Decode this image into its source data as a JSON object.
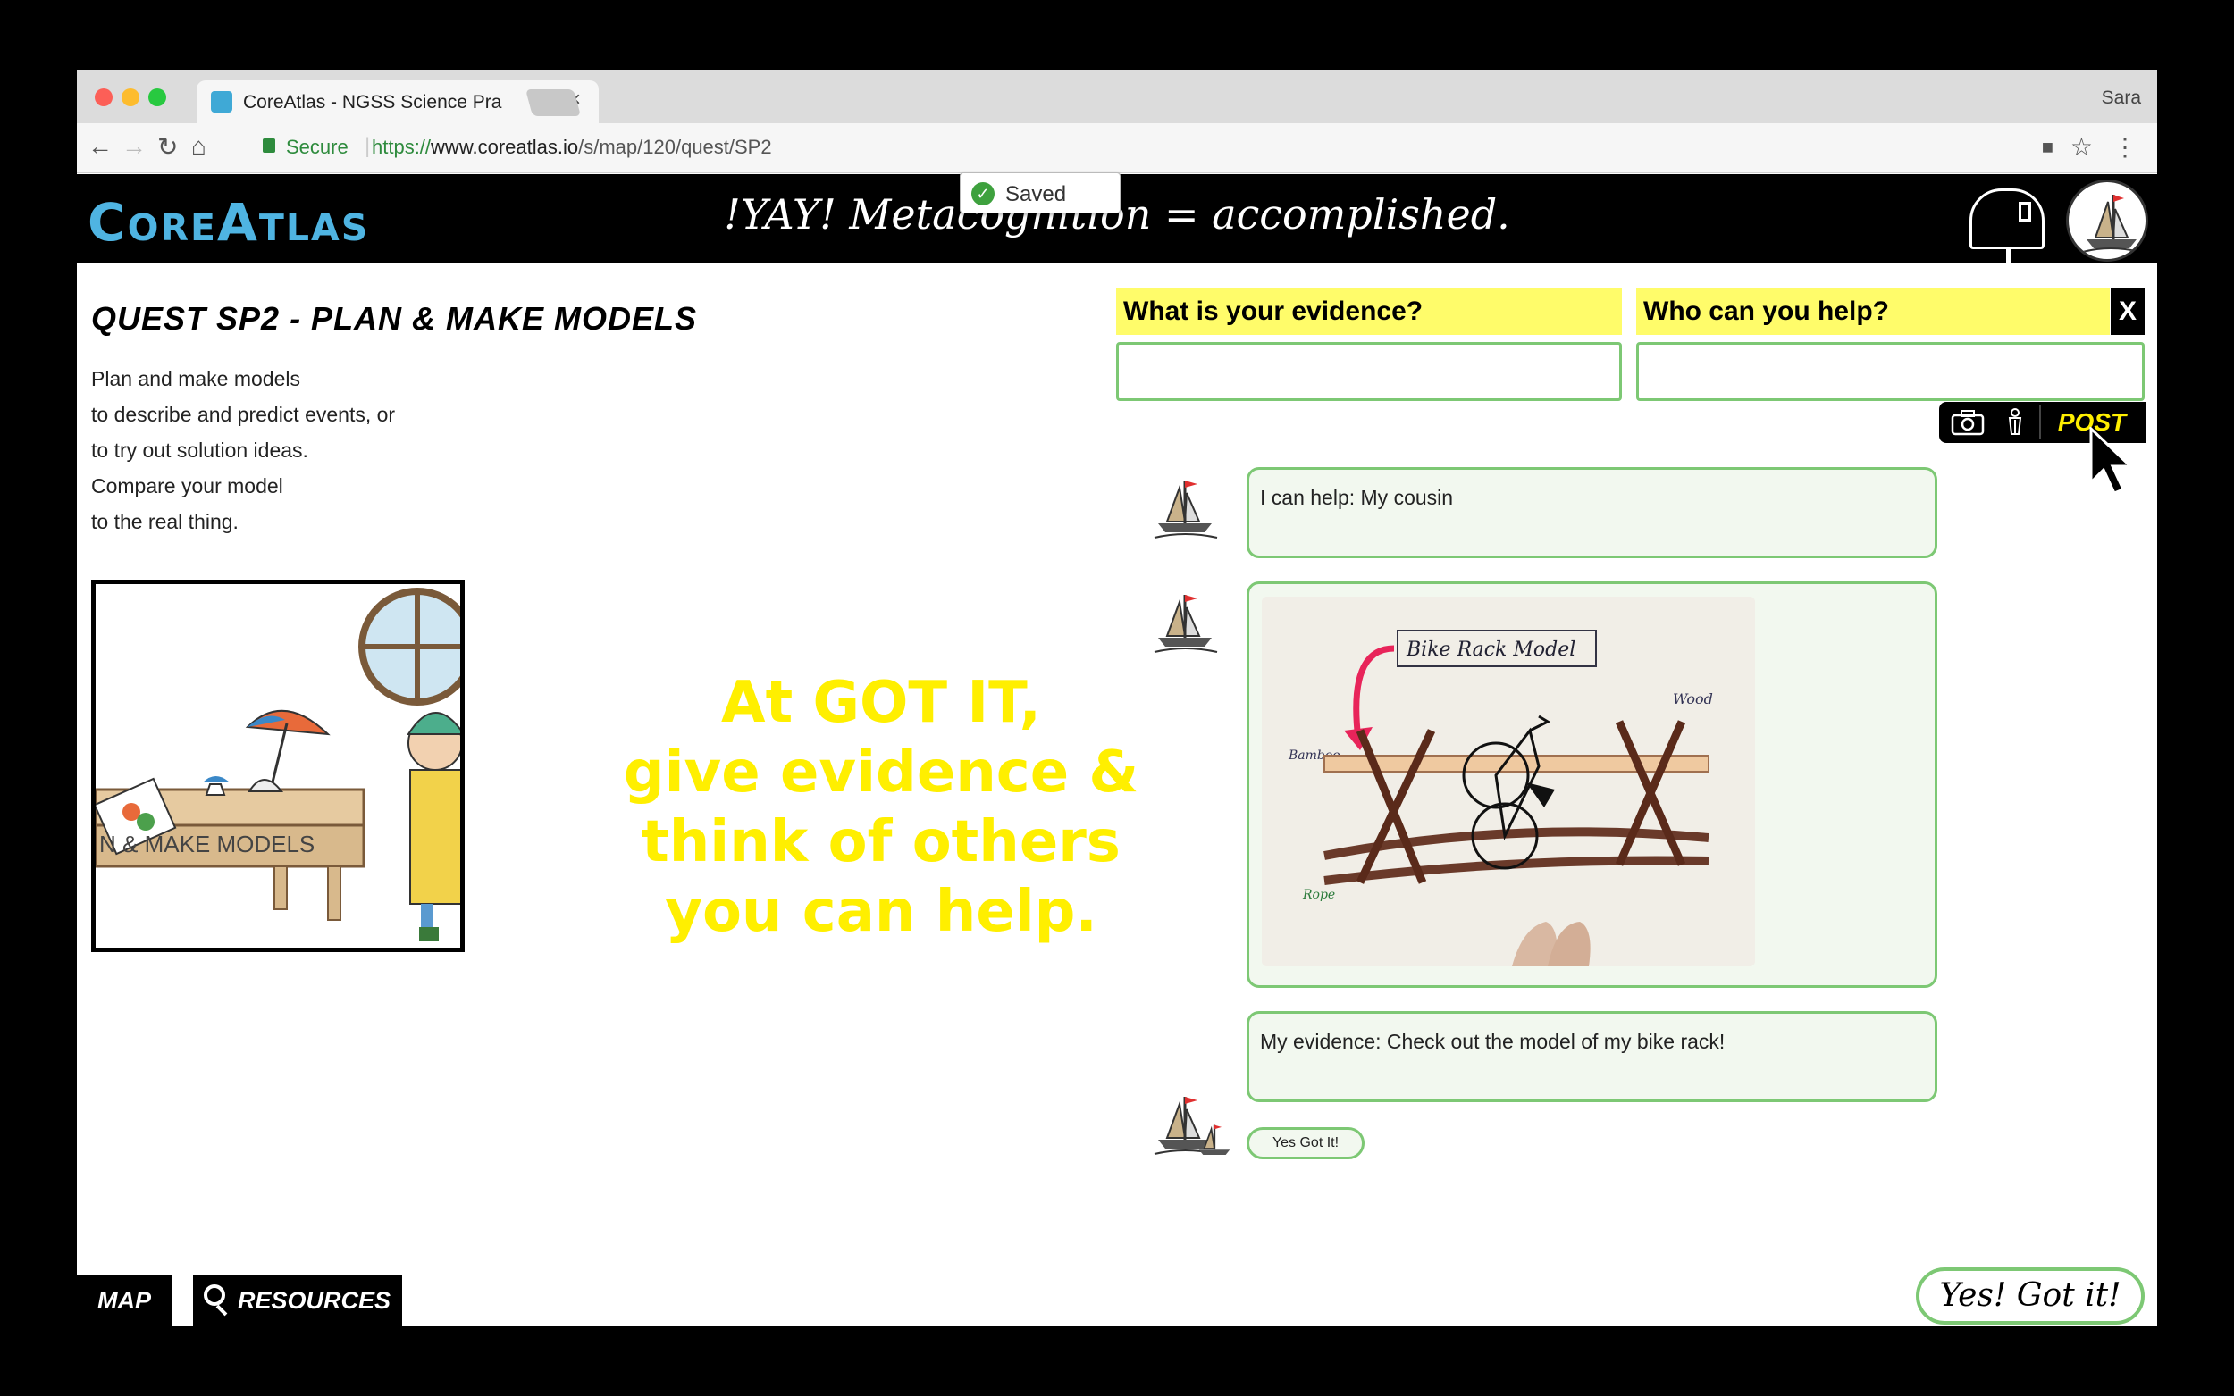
{
  "browser": {
    "tab_title": "CoreAtlas - NGSS Science Pra",
    "tab_close": "×",
    "profile_name": "Sara",
    "secure_label": "Secure",
    "url_scheme": "https://",
    "url_host": "www.coreatlas.io",
    "url_path": "/s/map/120/quest/SP2"
  },
  "app": {
    "logo": "CoreAtlas",
    "status_message": "!YAY! Metacognition = accomplished.",
    "saved_label": "Saved"
  },
  "quest": {
    "title": "QUEST SP2 - PLAN & MAKE MODELS",
    "description": [
      "Plan and make models",
      "to describe and predict events, or",
      "to try out solution ideas.",
      "Compare your model",
      "to the real thing."
    ],
    "image_caption": "N & MAKE MODELS"
  },
  "overlay_text": [
    "At GOT IT,",
    "give evidence &",
    "think of others",
    "you can help."
  ],
  "evidence_panel": {
    "prompt_evidence": "What is your evidence?",
    "prompt_help": "Who can you help?",
    "close_label": "X",
    "post_label": "POST"
  },
  "feed": {
    "help_post": "I can help: My cousin",
    "photo_labels": {
      "title": "Bike Rack Model",
      "wood": "Wood",
      "bamboo": "Bamboo",
      "rope": "Rope"
    },
    "evidence_post": "My evidence: Check out the model of my bike rack!",
    "got_it_chip": "Yes Got It!"
  },
  "footer": {
    "map_label": "MAP",
    "resources_label": "RESOURCES",
    "got_it_button": "Yes! Got it!"
  },
  "colors": {
    "accent_yellow": "#ffef00",
    "prompt_yellow": "#fffc6a",
    "bubble_border": "#7dc874",
    "logo_blue": "#4fb4e2"
  }
}
